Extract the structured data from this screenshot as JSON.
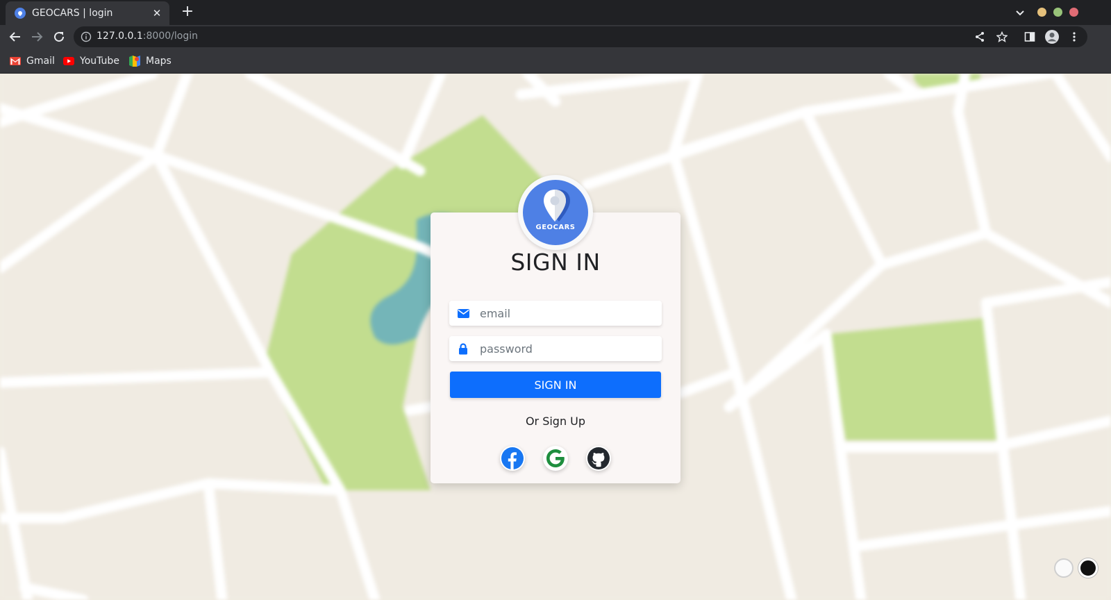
{
  "browser": {
    "tab_title": "GEOCARS | login",
    "tab_close": "✕",
    "new_tab": "+",
    "url_host": "127.0.0.1",
    "url_rest": ":8000/login",
    "bookmarks": [
      {
        "label": "Gmail",
        "icon": "gmail-icon"
      },
      {
        "label": "YouTube",
        "icon": "youtube-icon"
      },
      {
        "label": "Maps",
        "icon": "maps-icon"
      }
    ],
    "window_controls": [
      "#e5c07b",
      "#98c379",
      "#e06c75"
    ]
  },
  "login": {
    "logo_text": "GEOCARS",
    "title": "SIGN IN",
    "email_placeholder": "email",
    "password_placeholder": "password",
    "signin_label": "SIGN IN",
    "or_text": "Or Sign Up",
    "social": [
      "facebook-icon",
      "google-icon",
      "github-icon"
    ]
  },
  "colors": {
    "primary": "#0d6efd",
    "logo_blue": "#4e80e5",
    "facebook": "#1877f2",
    "google": "#1e8e3e",
    "github": "#24292f"
  },
  "theme_toggle": [
    "light",
    "dark"
  ]
}
